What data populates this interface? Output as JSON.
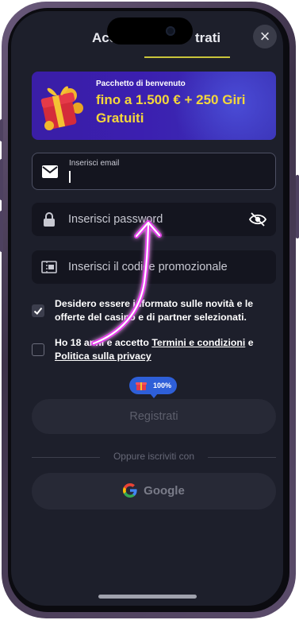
{
  "header": {
    "tab_login": "Acc",
    "tab_register": "trati",
    "close_symbol": "×"
  },
  "banner": {
    "title": "Pacchetto di benvenuto",
    "line1": "fino a 1.500 € + 250 Giri",
    "line2": "Gratuiti",
    "accent_color": "#f4d73b"
  },
  "form": {
    "email_label": "Inserisci email",
    "password_placeholder": "Inserisci password",
    "promo_placeholder": "Inserisci il codice promozionale",
    "icons": {
      "email": "mail-icon",
      "password": "lock-icon",
      "promo": "ticket-icon",
      "visibility": "eye-off-icon"
    }
  },
  "consents": {
    "marketing_text": "Desidero essere informato sulle novità e le offerte del casinò e di partner selezionati.",
    "marketing_checked": true,
    "age_text_prefix": "Ho 18 anni e accetto ",
    "terms_link": "Termini e condizioni",
    "and_text": " e",
    "privacy_link": "Politica sulla privacy",
    "age_checked": false
  },
  "strength_badge": "100%",
  "buttons": {
    "register": "Registrati",
    "divider": "Oppure iscriviti con",
    "google": "Google"
  }
}
